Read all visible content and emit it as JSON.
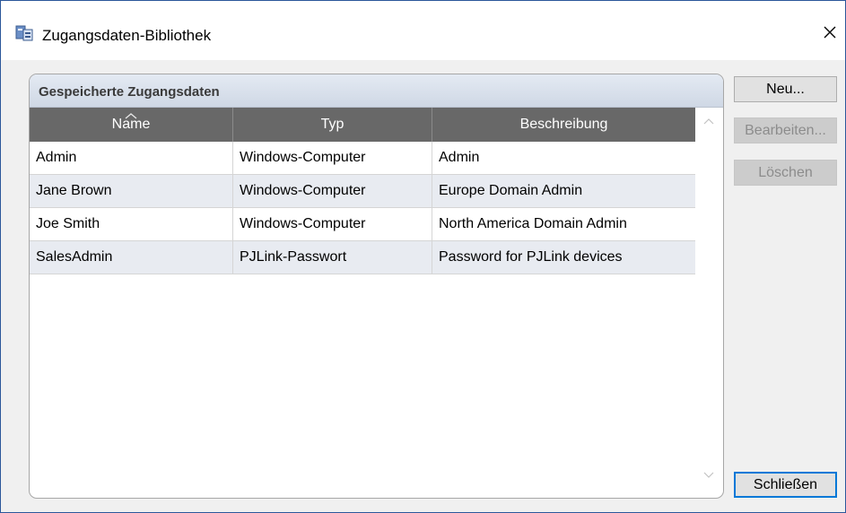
{
  "window": {
    "title": "Zugangsdaten-Bibliothek",
    "close_symbol": "✕"
  },
  "group": {
    "title": "Gespeicherte Zugangsdaten"
  },
  "table": {
    "columns": [
      "Name",
      "Typ",
      "Beschreibung"
    ],
    "sort_column": "Name",
    "rows": [
      [
        "Admin",
        "Windows-Computer",
        "Admin"
      ],
      [
        "Jane Brown",
        "Windows-Computer",
        "Europe Domain Admin"
      ],
      [
        "Joe Smith",
        "Windows-Computer",
        "North America Domain Admin"
      ],
      [
        "SalesAdmin",
        "PJLink-Passwort",
        "Password for PJLink devices"
      ]
    ]
  },
  "buttons": {
    "new": "Neu...",
    "edit": "Bearbeiten...",
    "delete": "Löschen",
    "close": "Schließen"
  },
  "colors": {
    "header_bg": "#686868",
    "alt_row": "#e8ebf1",
    "focus_border": "#0078d7"
  }
}
